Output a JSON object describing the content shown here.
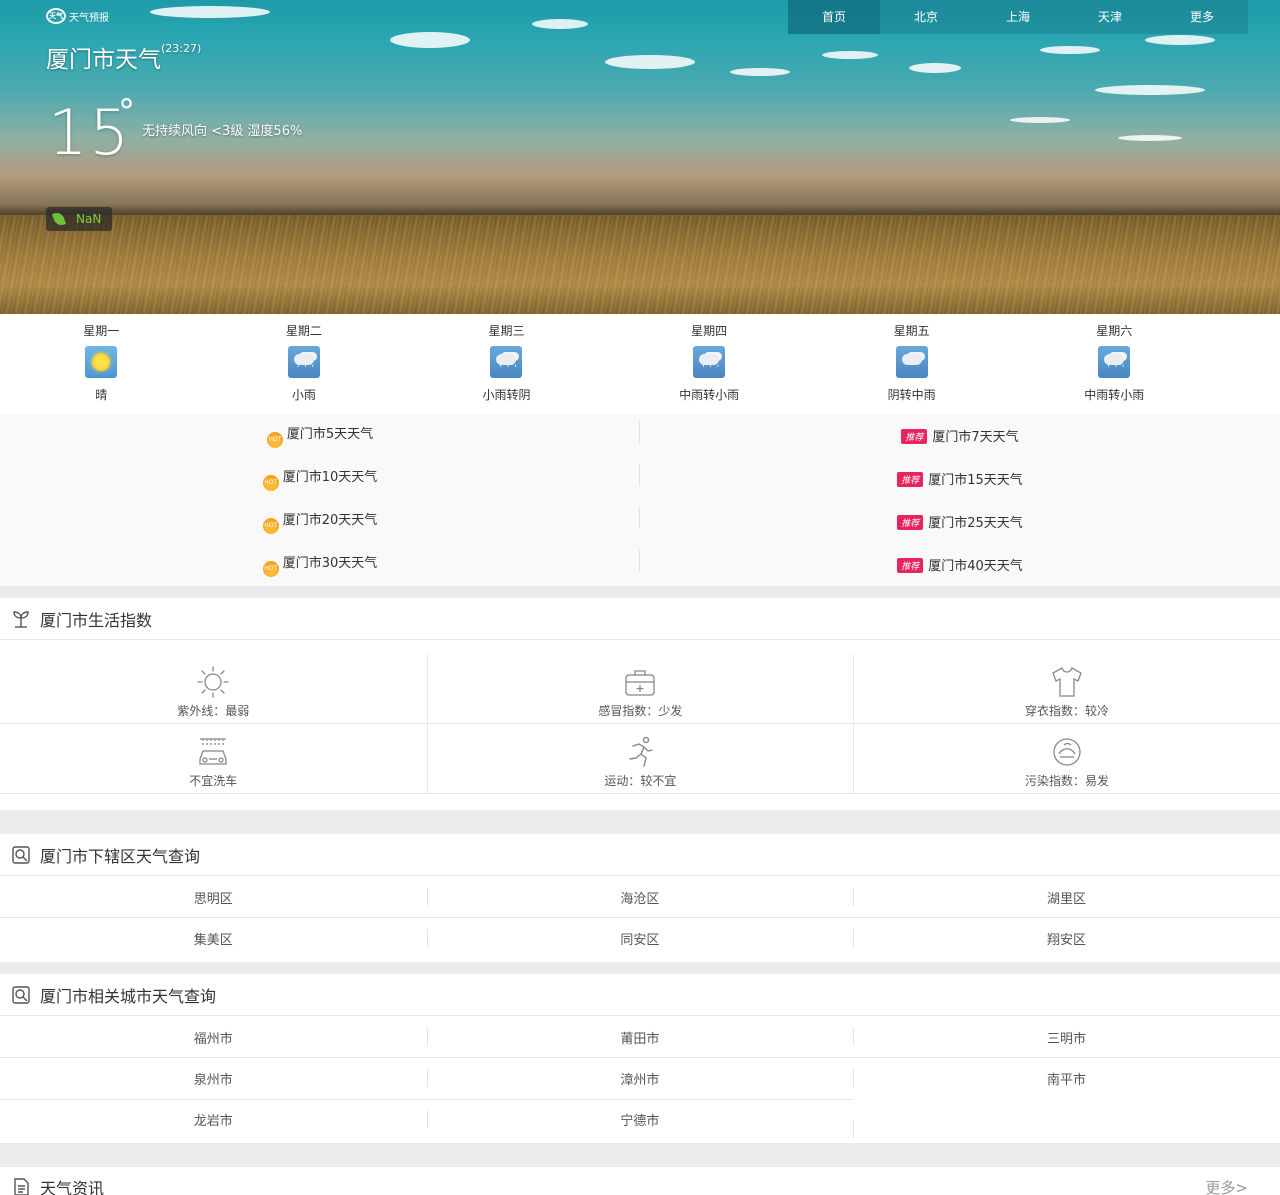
{
  "logo": {
    "mark": "天气",
    "text": "天气预报"
  },
  "nav": [
    "首页",
    "北京",
    "上海",
    "天津",
    "更多"
  ],
  "current": {
    "city_title": "厦门市天气",
    "time": "(23:27)",
    "temperature": "15",
    "degree": "°",
    "conditions": "无持续风向 <3级 湿度56%",
    "aqi": "NaN"
  },
  "forecast": [
    {
      "day": "星期一",
      "desc": "晴",
      "icon": "sunny-icon"
    },
    {
      "day": "星期二",
      "desc": "小雨",
      "icon": "light-rain-icon"
    },
    {
      "day": "星期三",
      "desc": "小雨转阴",
      "icon": "light-rain-icon"
    },
    {
      "day": "星期四",
      "desc": "中雨转小雨",
      "icon": "moderate-rain-icon"
    },
    {
      "day": "星期五",
      "desc": "阴转中雨",
      "icon": "overcast-icon"
    },
    {
      "day": "星期六",
      "desc": "中雨转小雨",
      "icon": "moderate-rain-icon"
    }
  ],
  "hot_badge": "HOT",
  "rec_badge": "推荐",
  "range_links": [
    {
      "left": "厦门市5天天气",
      "right": "厦门市7天天气"
    },
    {
      "left": "厦门市10天天气",
      "right": "厦门市15天天气"
    },
    {
      "left": "厦门市20天天气",
      "right": "厦门市25天天气"
    },
    {
      "left": "厦门市30天天气",
      "right": "厦门市40天天气"
    }
  ],
  "life": {
    "title": "厦门市生活指数",
    "items": [
      {
        "text": "紫外线：最弱",
        "icon": "sun-outline-icon"
      },
      {
        "text": "感冒指数：少发",
        "icon": "medical-kit-icon"
      },
      {
        "text": "穿衣指数：较冷",
        "icon": "shirt-icon"
      },
      {
        "text": "不宜洗车",
        "icon": "car-wash-icon"
      },
      {
        "text": "运动：较不宜",
        "icon": "running-icon"
      },
      {
        "text": "污染指数：易发",
        "icon": "pollution-icon"
      }
    ]
  },
  "districts": {
    "title": "厦门市下辖区天气查询",
    "items": [
      "思明区",
      "海沧区",
      "湖里区",
      "集美区",
      "同安区",
      "翔安区"
    ]
  },
  "related": {
    "title": "厦门市相关城市天气查询",
    "items": [
      "福州市",
      "莆田市",
      "三明市",
      "泉州市",
      "漳州市",
      "南平市",
      "龙岩市",
      "宁德市"
    ]
  },
  "news": {
    "title": "天气资讯",
    "more": "更多>"
  },
  "colors": {
    "rec_tag": "#e8245c",
    "hot_icon": "#f28c12",
    "aqi_green": "#7ccf3a"
  }
}
